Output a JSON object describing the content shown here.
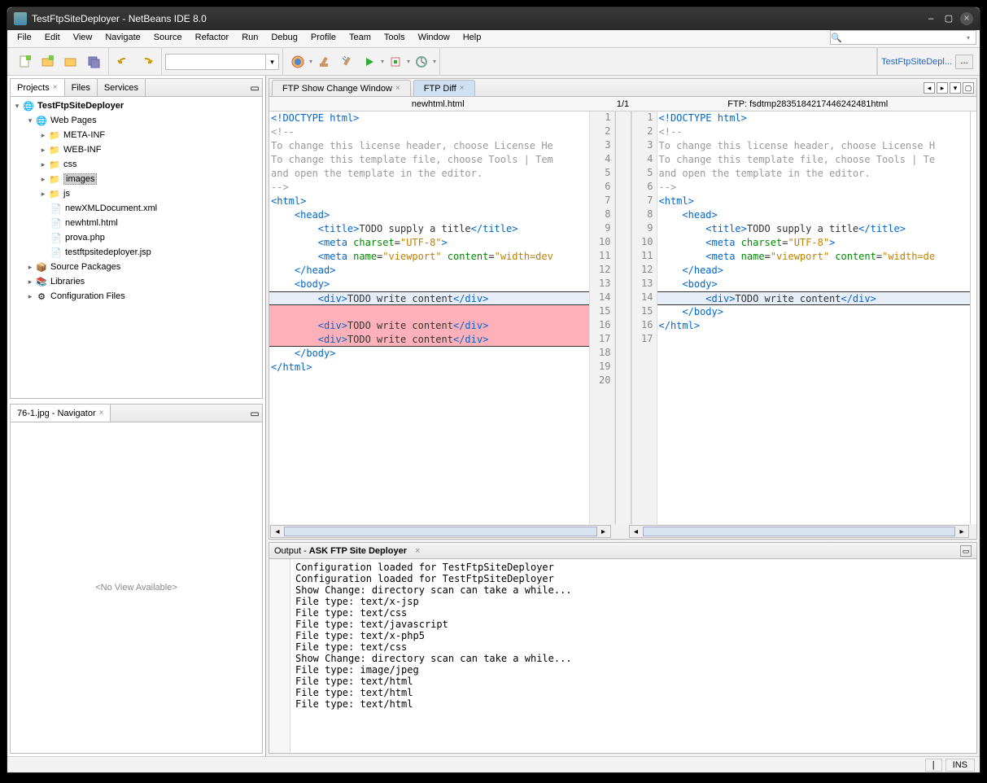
{
  "window": {
    "title": "TestFtpSiteDeployer - NetBeans IDE 8.0"
  },
  "menu": [
    "File",
    "Edit",
    "View",
    "Navigate",
    "Source",
    "Refactor",
    "Run",
    "Debug",
    "Profile",
    "Team",
    "Tools",
    "Window",
    "Help"
  ],
  "toolbar_right": {
    "link": "TestFtpSiteDepl...",
    "dots": "..."
  },
  "projects": {
    "tabs": [
      {
        "label": "Projects",
        "closable": true,
        "active": true
      },
      {
        "label": "Files",
        "closable": false,
        "active": false
      },
      {
        "label": "Services",
        "closable": false,
        "active": false
      }
    ],
    "tree": {
      "root": {
        "label": "TestFtpSiteDeployer",
        "expanded": true,
        "icon": "project"
      },
      "webpages": {
        "label": "Web Pages",
        "expanded": true,
        "icon": "folder-web"
      },
      "folders": [
        {
          "label": "META-INF",
          "icon": "folder"
        },
        {
          "label": "WEB-INF",
          "icon": "folder"
        },
        {
          "label": "css",
          "icon": "folder"
        },
        {
          "label": "images",
          "icon": "folder",
          "selected": true
        },
        {
          "label": "js",
          "icon": "folder"
        }
      ],
      "files": [
        {
          "label": "newXMLDocument.xml",
          "icon": "xml"
        },
        {
          "label": "newhtml.html",
          "icon": "html"
        },
        {
          "label": "prova.php",
          "icon": "php"
        },
        {
          "label": "testftpsitedeployer.jsp",
          "icon": "jsp"
        }
      ],
      "bottom": [
        {
          "label": "Source Packages",
          "icon": "pkg"
        },
        {
          "label": "Libraries",
          "icon": "lib"
        },
        {
          "label": "Configuration Files",
          "icon": "cfg"
        }
      ]
    }
  },
  "navigator": {
    "title": "76-1.jpg - Navigator",
    "empty": "<No View Available>"
  },
  "editor_tabs": [
    {
      "label": "FTP Show Change Window",
      "active": false
    },
    {
      "label": "FTP Diff",
      "active": true
    }
  ],
  "diff": {
    "left_title": "newhtml.html",
    "mid": "1/1",
    "right_title": "FTP: fsdtmp28351842174462424­81html",
    "left_code": [
      {
        "n": 1,
        "type": "kw",
        "text": "<!DOCTYPE html>"
      },
      {
        "n": 2,
        "type": "cm",
        "text": "<!--"
      },
      {
        "n": 3,
        "type": "cm",
        "text": "To change this license header, choose License He"
      },
      {
        "n": 4,
        "type": "cm",
        "text": "To change this template file, choose Tools | Tem"
      },
      {
        "n": 5,
        "type": "cm",
        "text": "and open the template in the editor."
      },
      {
        "n": 6,
        "type": "cm",
        "text": "-->"
      },
      {
        "n": 7,
        "type": "tag",
        "text": "<html>"
      },
      {
        "n": 8,
        "type": "tag",
        "text": "    <head>"
      },
      {
        "n": 9,
        "type": "mixed",
        "text": "        <title>TODO supply a title</title>"
      },
      {
        "n": 10,
        "type": "meta",
        "text": "        <meta charset=\"UTF-8\">"
      },
      {
        "n": 11,
        "type": "meta2",
        "text": "        <meta name=\"viewport\" content=\"width=dev"
      },
      {
        "n": 12,
        "type": "tag",
        "text": "    </head>"
      },
      {
        "n": 13,
        "type": "tag",
        "text": "    <body>"
      },
      {
        "n": 14,
        "type": "mixed",
        "text": "        <div>TODO write content</div>",
        "hl": true
      },
      {
        "n": 15,
        "type": "blank",
        "text": "",
        "del": true
      },
      {
        "n": 16,
        "type": "mixed",
        "text": "        <div>TODO write content</div>",
        "del": true
      },
      {
        "n": 17,
        "type": "mixed",
        "text": "        <div>TODO write content</div>",
        "del": true,
        "last": true
      },
      {
        "n": 18,
        "type": "tag",
        "text": "    </body>"
      },
      {
        "n": 19,
        "type": "tag",
        "text": "</html>"
      },
      {
        "n": 20,
        "type": "plain",
        "text": ""
      }
    ],
    "right_code": [
      {
        "n": 1,
        "type": "kw",
        "text": "<!DOCTYPE html>"
      },
      {
        "n": 2,
        "type": "cm",
        "text": "<!--"
      },
      {
        "n": 3,
        "type": "cm",
        "text": "To change this license header, choose License H"
      },
      {
        "n": 4,
        "type": "cm",
        "text": "To change this template file, choose Tools | Te"
      },
      {
        "n": 5,
        "type": "cm",
        "text": "and open the template in the editor."
      },
      {
        "n": 6,
        "type": "cm",
        "text": "-->"
      },
      {
        "n": 7,
        "type": "tag",
        "text": "<html>"
      },
      {
        "n": 8,
        "type": "tag",
        "text": "    <head>"
      },
      {
        "n": 9,
        "type": "mixed",
        "text": "        <title>TODO supply a title</title>"
      },
      {
        "n": 10,
        "type": "meta",
        "text": "        <meta charset=\"UTF-8\">"
      },
      {
        "n": 11,
        "type": "meta2",
        "text": "        <meta name=\"viewport\" content=\"width=de"
      },
      {
        "n": 12,
        "type": "tag",
        "text": "    </head>"
      },
      {
        "n": 13,
        "type": "tag",
        "text": "    <body>"
      },
      {
        "n": 14,
        "type": "mixed",
        "text": "        <div>TODO write content</div>",
        "hl": true
      },
      {
        "n": 15,
        "type": "tag",
        "text": "    </body>"
      },
      {
        "n": 16,
        "type": "tag",
        "text": "</html>"
      },
      {
        "n": 17,
        "type": "plain",
        "text": ""
      }
    ]
  },
  "output": {
    "title_prefix": "Output - ",
    "title_bold": "ASK FTP Site Deployer",
    "lines": [
      "Configuration loaded for TestFtpSiteDeployer",
      "Configuration loaded for TestFtpSiteDeployer",
      "Show Change: directory scan can take a while...",
      "File type: text/x-jsp",
      "File type: text/css",
      "File type: text/javascript",
      "File type: text/x-php5",
      "File type: text/css",
      "Show Change: directory scan can take a while...",
      "File type: image/jpeg",
      "File type: text/html",
      "File type: text/html",
      "File type: text/html"
    ]
  },
  "status": {
    "pos": "|",
    "mode": "INS"
  }
}
